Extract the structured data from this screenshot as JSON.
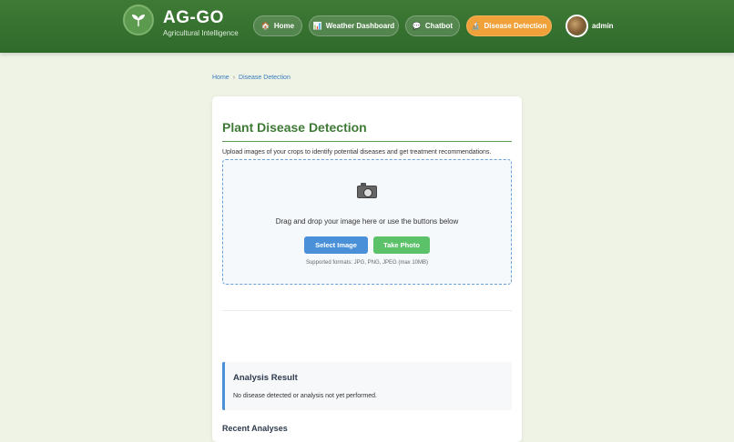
{
  "brand": {
    "title": "AG-GO",
    "subtitle": "Agricultural Intelligence",
    "logo_icon": "leaf-icon"
  },
  "nav": {
    "items": [
      {
        "label": "Home",
        "icon": "house-icon",
        "glyph": "🏠",
        "active": false
      },
      {
        "label": "Weather Dashboard",
        "icon": "chart-icon",
        "glyph": "📊",
        "active": false
      },
      {
        "label": "Chatbot",
        "icon": "speech-bubble-icon",
        "glyph": "💬",
        "active": false
      },
      {
        "label": "Disease Detection",
        "icon": "microscope-icon",
        "glyph": "🔬",
        "active": true
      }
    ],
    "active_color": "#f0a13a"
  },
  "user": {
    "name": "admin"
  },
  "breadcrumb": {
    "home": "Home",
    "separator": "›",
    "current": "Disease Detection"
  },
  "detection": {
    "title": "Plant Disease Detection",
    "intro": "Upload images of your crops to identify potential diseases and get treatment recommendations.",
    "drop_text": "Drag and drop your image here or use the buttons below",
    "select_label": "Select Image",
    "photo_label": "Take Photo",
    "formats": "Supported formats: JPG, PNG, JPEG (max 10MB)"
  },
  "result": {
    "title": "Analysis Result",
    "text": "No disease detected or analysis not yet performed."
  },
  "recent": {
    "title": "Recent Analyses"
  },
  "colors": {
    "header": "#3f7a36",
    "title_green": "#3f7a36",
    "select_button": "#4a90d9",
    "photo_button": "#5cc26a",
    "link": "#3a7bbf"
  }
}
